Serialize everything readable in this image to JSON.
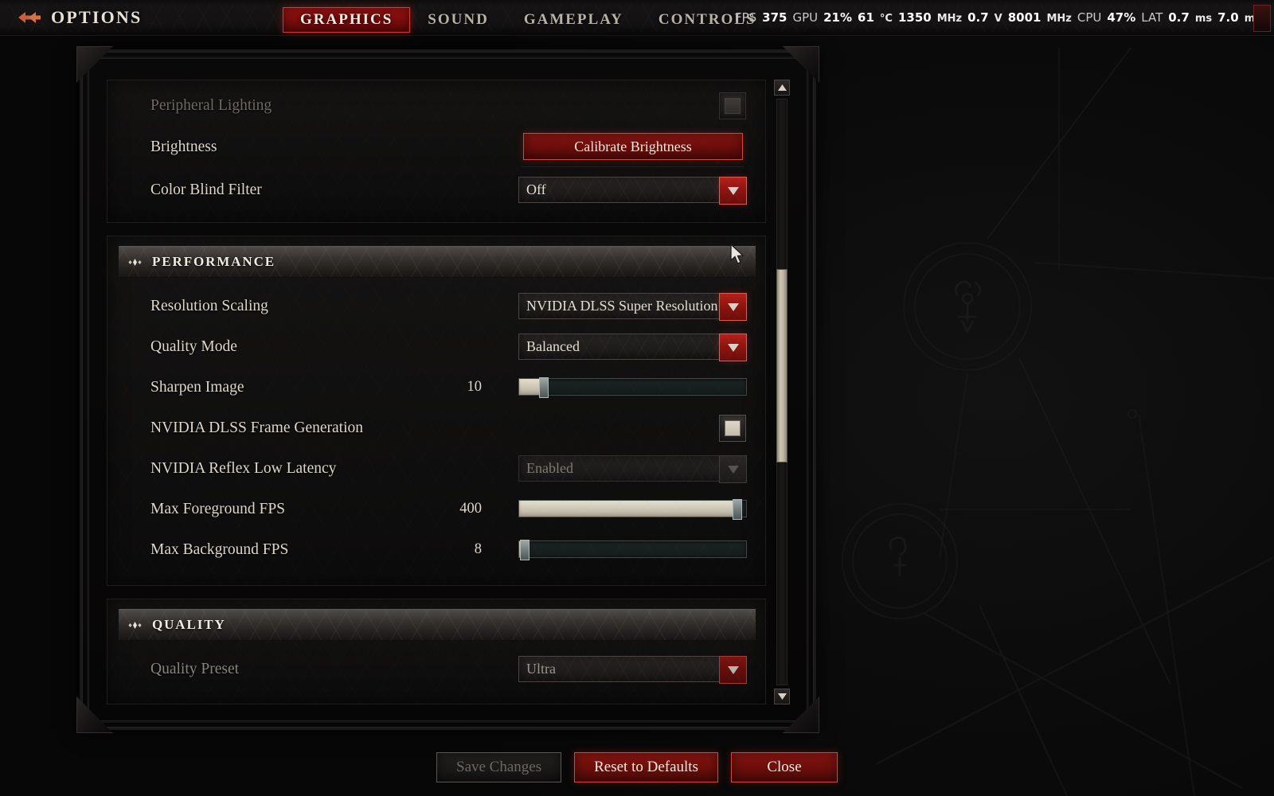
{
  "header": {
    "options_label": "OPTIONS",
    "options_icon": "double-arrow-icon",
    "tabs": [
      {
        "label": "GRAPHICS",
        "active": true
      },
      {
        "label": "SOUND",
        "active": false
      },
      {
        "label": "GAMEPLAY",
        "active": false
      },
      {
        "label": "CONTROLS",
        "active": false
      }
    ],
    "active_accent": "#9d1212"
  },
  "perf_overlay": {
    "items": [
      {
        "key": "FPS",
        "value": "375",
        "unit": ""
      },
      {
        "key": "GPU",
        "value": "21%",
        "unit": ""
      },
      {
        "key": "",
        "value": "61",
        "unit": "°C"
      },
      {
        "key": "",
        "value": "1350",
        "unit": "MHz"
      },
      {
        "key": "",
        "value": "0.7",
        "unit": "V"
      },
      {
        "key": "",
        "value": "8001",
        "unit": "MHz"
      },
      {
        "key": "CPU",
        "value": "47%",
        "unit": ""
      },
      {
        "key": "LAT",
        "value": "0.7",
        "unit": "ms"
      },
      {
        "key": "",
        "value": "7.0",
        "unit": "ms"
      }
    ]
  },
  "display_block": {
    "rows": [
      {
        "label": "Peripheral Lighting",
        "type": "checkbox",
        "checked": true,
        "disabled": true
      },
      {
        "label": "Brightness",
        "type": "button",
        "button_label": "Calibrate Brightness"
      },
      {
        "label": "Color Blind Filter",
        "type": "dropdown",
        "value": "Off"
      }
    ]
  },
  "performance_block": {
    "title": "PERFORMANCE",
    "icon": "diamond-cluster-icon",
    "rows": [
      {
        "label": "Resolution Scaling",
        "type": "dropdown",
        "value": "NVIDIA DLSS Super Resolution"
      },
      {
        "label": "Quality Mode",
        "type": "dropdown",
        "value": "Balanced"
      },
      {
        "label": "Sharpen Image",
        "type": "slider",
        "value": "10",
        "percent": 11
      },
      {
        "label": "NVIDIA DLSS Frame Generation",
        "type": "checkbox",
        "checked": true,
        "disabled": false
      },
      {
        "label": "NVIDIA Reflex Low Latency",
        "type": "dropdown",
        "value": "Enabled",
        "disabled": true
      },
      {
        "label": "Max Foreground FPS",
        "type": "slider",
        "value": "400",
        "percent": 96
      },
      {
        "label": "Max Background FPS",
        "type": "slider",
        "value": "8",
        "percent": 2
      }
    ]
  },
  "quality_block": {
    "title": "QUALITY",
    "icon": "diamond-cluster-icon",
    "rows": [
      {
        "label": "Quality Preset",
        "type": "dropdown",
        "value": "Ultra"
      }
    ]
  },
  "scrollbar": {
    "up_icon": "triangle-up-icon",
    "down_icon": "triangle-down-icon",
    "thumb_position_percent": 31
  },
  "footer": {
    "save_label": "Save Changes",
    "save_disabled": true,
    "reset_label": "Reset to Defaults",
    "close_label": "Close"
  },
  "cursor": {
    "icon": "mouse-pointer-icon"
  }
}
